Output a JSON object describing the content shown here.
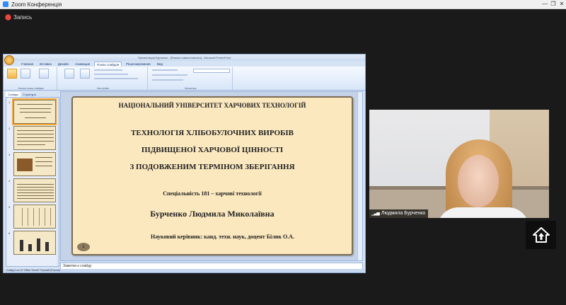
{
  "zoom": {
    "title": "Zoom Конференція",
    "recording_label": "Запись",
    "window_controls": [
      "—",
      "❐",
      "✕"
    ]
  },
  "ppt": {
    "window_title": "Презентация Бурченко - [Режим совместимости] - Microsoft PowerPoint",
    "tabs": [
      "Главная",
      "Вставка",
      "Дизайн",
      "Анимация",
      "Показ слайдов",
      "Рецензирование",
      "Вид"
    ],
    "active_tab": "Показ слайдов",
    "ribbon_groups": [
      "Начать показ слайдов",
      "Настройка",
      "Мониторы"
    ],
    "pane_tabs": [
      "Слайды",
      "Структура"
    ],
    "notes_placeholder": "Заметки к слайду",
    "status_text": "Слайд 1 из 16   \"Office Theme\"   Русский (Россия)",
    "slide_count": 6
  },
  "slide": {
    "university": "НАЦІОНАЛЬНИЙ УНІВЕРСИТЕТ ХАРЧОВИХ ТЕХНОЛОГІЙ",
    "title_line1": "ТЕХНОЛОГІЯ ХЛІБОБУЛОЧНИХ ВИРОБІВ",
    "title_line2": "ПІДВИЩЕНОЇ ХАРЧОВОЇ ЦІННОСТІ",
    "title_line3": "З ПОДОВЖЕНИМ ТЕРМІНОМ ЗБЕРІГАННЯ",
    "specialty": "Спеціальність 181 – харчові технології",
    "author": "Бурченко Людмила Миколаївна",
    "supervisor": "Науковий керівник: канд. техн. наук, доцент Білик О.А.",
    "number": "1"
  },
  "participant": {
    "name": "Людмила Бурченко",
    "signal_icon": "signal-bars-icon"
  },
  "colors": {
    "slide_bg": "#fbe8bf",
    "zoom_bg": "#1a1a1a",
    "ribbon_bg": "#d8e6f8"
  }
}
